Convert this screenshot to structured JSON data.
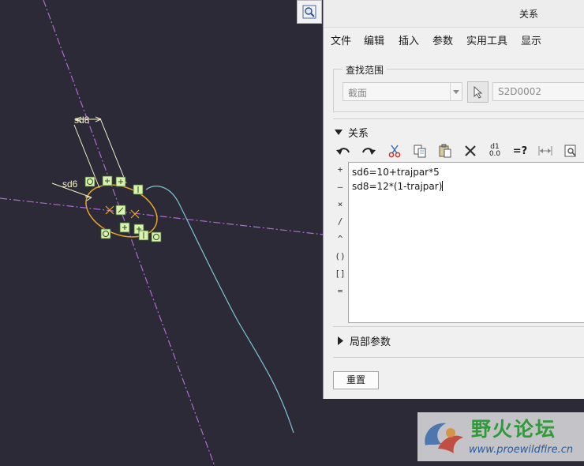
{
  "dialog": {
    "title": "关系",
    "menu": [
      "文件",
      "编辑",
      "插入",
      "参数",
      "实用工具",
      "显示"
    ],
    "lookup": {
      "label": "查找范围",
      "scope_value": "截面",
      "selection_value": "S2D0002"
    },
    "relations_section": "关系",
    "relations": [
      "sd6=10+trajpar*5",
      "sd8=12*(1-trajpar)"
    ],
    "operators": [
      "+",
      "–",
      "×",
      "/",
      "^",
      "()",
      "[]",
      "="
    ],
    "toolbar_d1_label": "d1",
    "toolbar_d1_sub": "0.0",
    "toolbar_eq_label": "=?",
    "local_params_section": "局部参数",
    "reset_label": "重置"
  },
  "sketch": {
    "dim_labels": [
      "sd8",
      "sd6"
    ],
    "colors": {
      "background": "#2b2a36",
      "centerline": "#b06ad6",
      "trajectory": "#7fc4d4",
      "section": "#e8a62a",
      "dimension": "#f4f0c8",
      "constraint": "#d9f2b0"
    }
  },
  "watermark": {
    "title": "野火论坛",
    "url": "www.proewildfire.cn"
  }
}
